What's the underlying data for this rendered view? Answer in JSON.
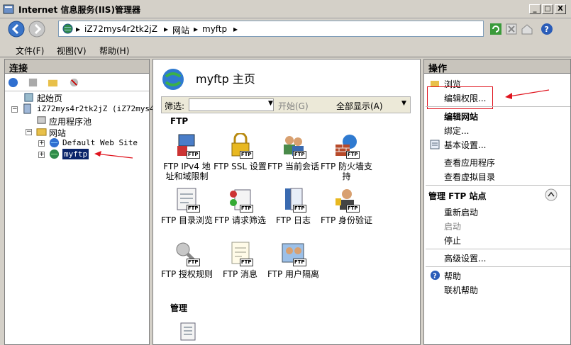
{
  "window": {
    "title": "Internet 信息服务(IIS)管理器",
    "minimize": "_",
    "maximize": "□",
    "close": "X"
  },
  "address": {
    "crumbs": [
      "iZ72mys4r2tk2jZ",
      "网站",
      "myftp"
    ]
  },
  "menu": {
    "items": [
      "文件(F)",
      "视图(V)",
      "帮助(H)"
    ]
  },
  "left": {
    "title": "连接",
    "tree": {
      "start": "起始页",
      "server": "iZ72mys4r2tk2jZ (iZ72mys4r",
      "apppools": "应用程序池",
      "sites": "网站",
      "default_site": "Default Web Site",
      "myftp": "myftp"
    }
  },
  "center": {
    "title": "myftp 主页",
    "filter_label": "筛选:",
    "start_btn": "开始(G)",
    "showall_btn": "全部显示(A)",
    "group_ftp": "FTP",
    "group_manage": "管理",
    "features": [
      {
        "label": "FTP IPv4 地址和域限制",
        "icon": "ip-restriction-icon"
      },
      {
        "label": "FTP SSL 设置",
        "icon": "lock-icon"
      },
      {
        "label": "FTP 当前会话",
        "icon": "sessions-icon"
      },
      {
        "label": "FTP 防火墙支持",
        "icon": "firewall-icon"
      },
      {
        "label": "FTP 目录浏览",
        "icon": "directory-browse-icon"
      },
      {
        "label": "FTP 请求筛选",
        "icon": "request-filter-icon"
      },
      {
        "label": "FTP 日志",
        "icon": "log-icon"
      },
      {
        "label": "FTP 身份验证",
        "icon": "authentication-icon"
      },
      {
        "label": "FTP 授权规则",
        "icon": "authorization-icon"
      },
      {
        "label": "FTP 消息",
        "icon": "message-icon"
      },
      {
        "label": "FTP 用户隔离",
        "icon": "user-isolation-icon"
      }
    ],
    "ftp_badge": "FTP"
  },
  "right": {
    "title": "操作",
    "browse": "浏览",
    "edit_perms": "编辑权限...",
    "edit_site_head": "编辑网站",
    "bindings": "绑定...",
    "basic_settings": "基本设置...",
    "view_apps": "查看应用程序",
    "view_vdirs": "查看虚拟目录",
    "manage_head": "管理 FTP 站点",
    "restart": "重新启动",
    "start": "启动",
    "stop": "停止",
    "advanced": "高级设置...",
    "help": "帮助",
    "online_help": "联机帮助"
  },
  "colors": {
    "annotation_red": "#e0141e",
    "selection": "#0a246a"
  }
}
